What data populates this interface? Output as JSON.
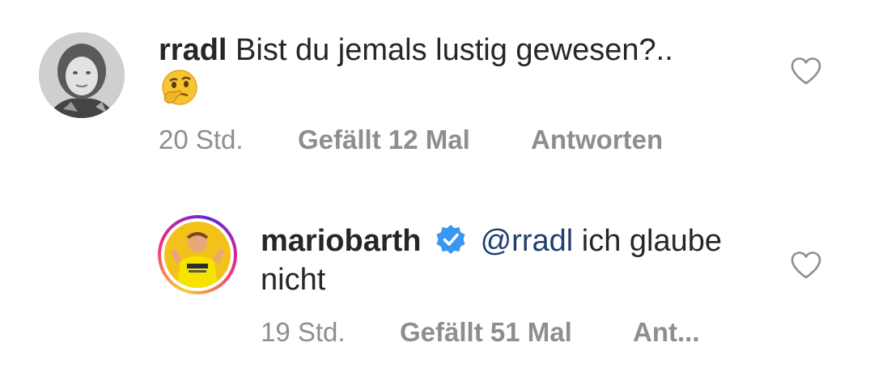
{
  "comments": [
    {
      "username": "rradl",
      "text": "Bist du jemals lustig gewesen?..",
      "emoji": "🤔",
      "emoji_name": "thinking-face-icon",
      "time": "20 Std.",
      "likes": "Gefällt 12 Mal",
      "reply": "Antworten",
      "avatar": "grayscale-profile-photo"
    },
    {
      "username": "mariobarth",
      "verified": true,
      "mention": "@rradl",
      "text_line1": "ich glaube",
      "text_line2": "nicht",
      "time": "19 Std.",
      "likes": "Gefällt 51 Mal",
      "reply": "Ant...",
      "avatar": "story-ring-profile-photo"
    }
  ],
  "colors": {
    "text": "#262626",
    "meta": "#8e8e8e",
    "mention": "#1f3f71",
    "verified": "#3897f0"
  }
}
